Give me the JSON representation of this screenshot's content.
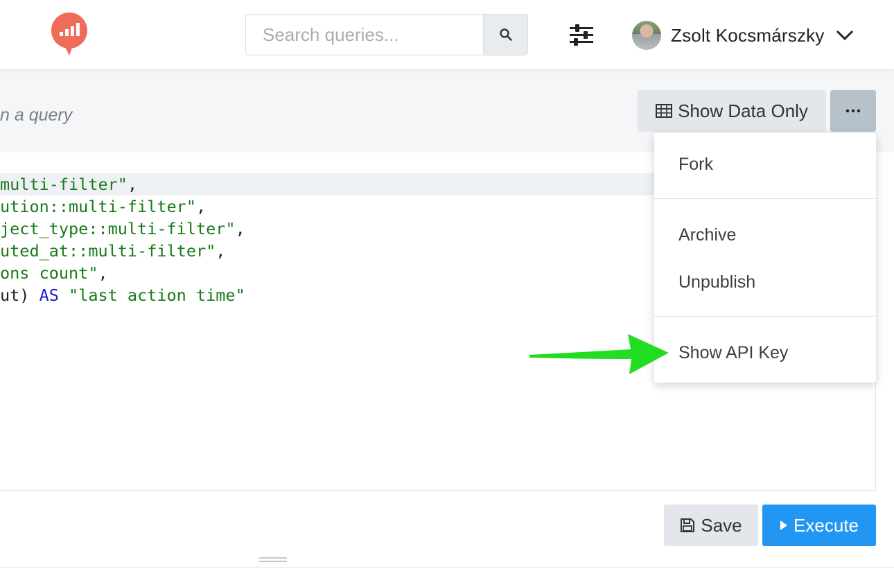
{
  "header": {
    "search_placeholder": "Search queries...",
    "user_name": "Zsolt Kocsmárszky"
  },
  "query": {
    "description": "n a query",
    "show_data_only_label": "Show Data Only",
    "more_label": "···"
  },
  "editor": {
    "lines": [
      {
        "pre": "",
        "str": "multi-filter\"",
        "post": ","
      },
      {
        "pre": "",
        "str": "ution::multi-filter\"",
        "post": ","
      },
      {
        "pre": "",
        "str": "ject_type::multi-filter\"",
        "post": ","
      },
      {
        "pre": "",
        "str": "uted_at::multi-filter\"",
        "post": ","
      },
      {
        "pre": "",
        "str": "ons count\"",
        "post": ","
      },
      {
        "pre": "ut) ",
        "kw": "AS",
        "str": "\"last action time\"",
        "post": ""
      }
    ]
  },
  "actions": {
    "save_label": "Save",
    "execute_label": "Execute"
  },
  "dropdown": {
    "items": [
      "Fork",
      "Archive",
      "Unpublish",
      "Show API Key"
    ]
  },
  "colors": {
    "accent": "#2196f3",
    "logo": "#ef6c5a",
    "annotation_arrow": "#22dd22"
  }
}
